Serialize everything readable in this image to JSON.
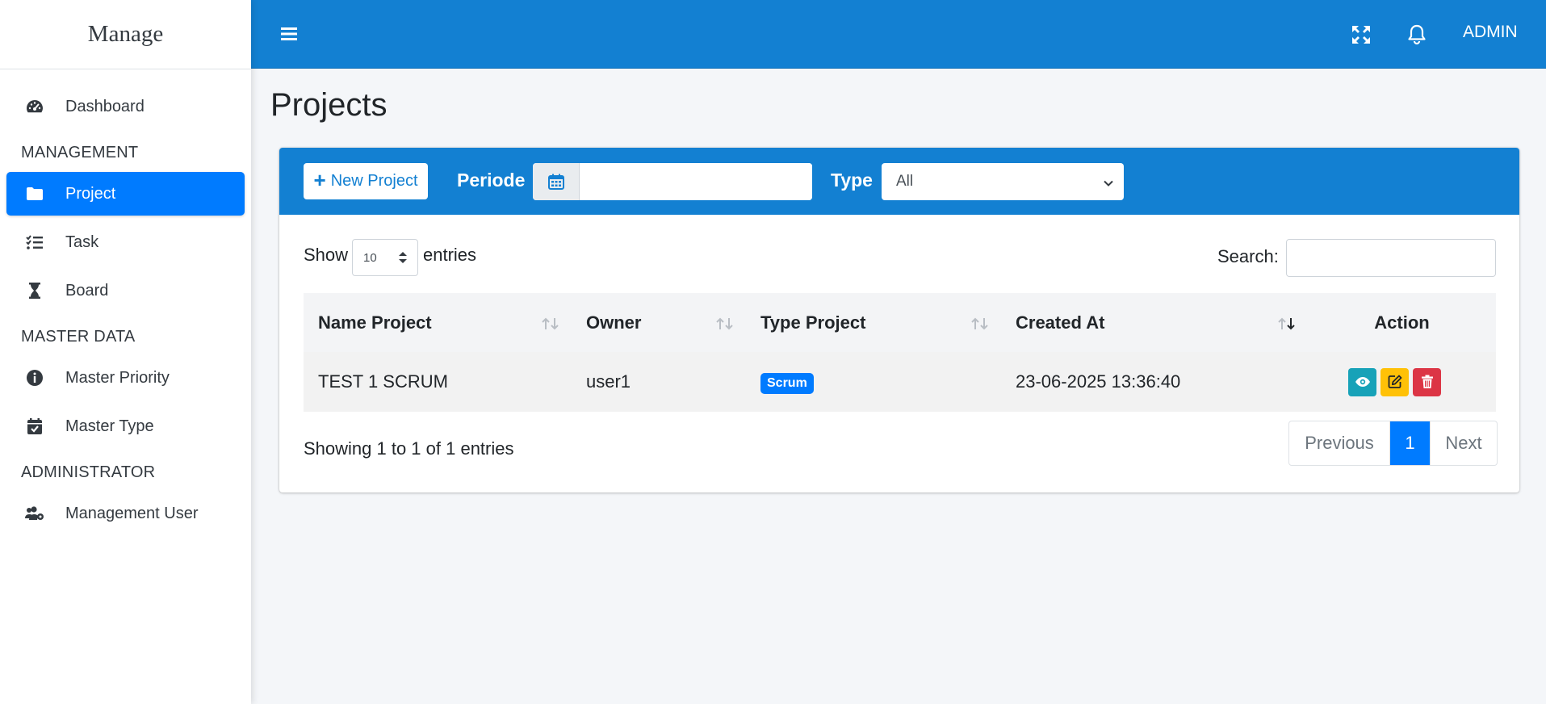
{
  "brand": "Manage",
  "sidebar": {
    "dashboard": "Dashboard",
    "section_management": "MANAGEMENT",
    "project": "Project",
    "task": "Task",
    "board": "Board",
    "section_master": "MASTER DATA",
    "master_priority": "Master Priority",
    "master_type": "Master Type",
    "section_admin": "ADMINISTRATOR",
    "management_user": "Management User"
  },
  "topbar": {
    "user": "ADMIN"
  },
  "page": {
    "title": "Projects"
  },
  "filters": {
    "new_project": "New Project",
    "periode_label": "Periode",
    "periode_value": "",
    "type_label": "Type",
    "type_selected": "All"
  },
  "table_controls": {
    "show": "Show",
    "entries_value": "10",
    "entries": "entries",
    "search": "Search:",
    "search_value": ""
  },
  "table": {
    "headers": [
      "Name Project",
      "Owner",
      "Type Project",
      "Created At",
      "Action"
    ],
    "rows": [
      {
        "name": "TEST 1 SCRUM",
        "owner": "user1",
        "type": "Scrum",
        "created": "23-06-2025 13:36:40"
      }
    ]
  },
  "footer": {
    "info": "Showing 1 to 1 of 1 entries",
    "previous": "Previous",
    "page": "1",
    "next": "Next"
  },
  "colors": {
    "primary": "#1380d2",
    "active": "#007bff",
    "view": "#17a2b8",
    "edit": "#ffc107",
    "delete": "#dc3545"
  }
}
